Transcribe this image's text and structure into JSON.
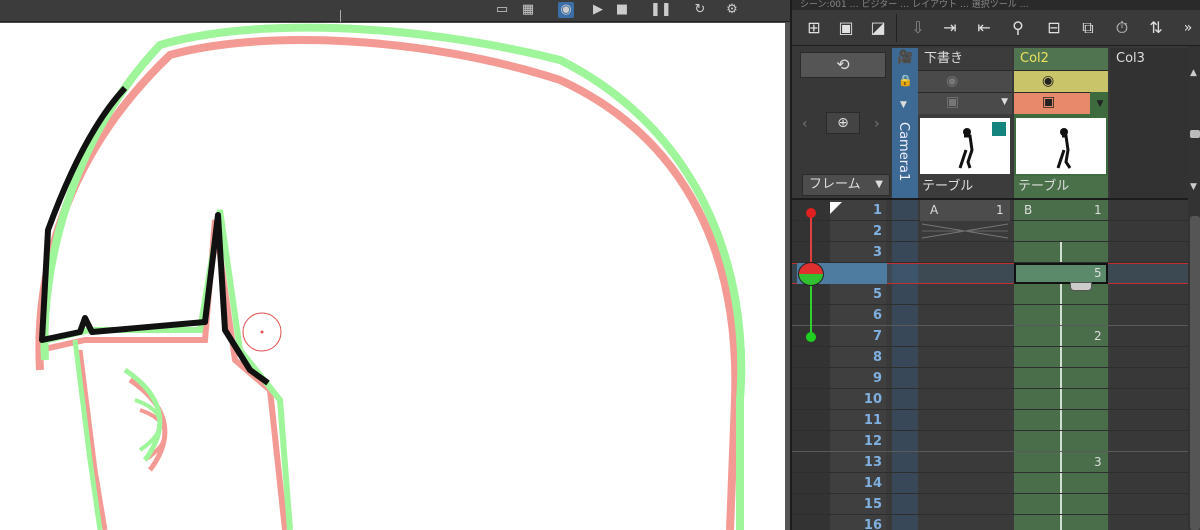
{
  "viewer": {
    "toolbar_icons": [
      "frame-icon",
      "grid-icon",
      "onion-skin-icon",
      "play-icon",
      "camera-icon",
      "pause-icon",
      "refresh-icon",
      "settings-icon"
    ]
  },
  "xsheet": {
    "title_text": "シーン:001 … ビジター … レイアウト … 選択ツール …",
    "toolbar_buttons": [
      "new-raster-level-icon",
      "new-toonz-level-icon",
      "new-vector-level-icon",
      "collapse-icon",
      "import-icon",
      "export-icon",
      "scene-cast-icon",
      "new-column-icon",
      "new-frame-icon",
      "timer-icon",
      "sort-icon"
    ],
    "more": "»",
    "frame_mode_label": "フレーム",
    "camera_label": "Camera1",
    "columns": [
      {
        "name": "下書き",
        "foot": "テーブル",
        "active": false
      },
      {
        "name": "Col2",
        "foot": "テーブル",
        "active": true
      },
      {
        "name": "Col3",
        "foot": "",
        "active": false
      }
    ],
    "frames": [
      "1",
      "2",
      "3",
      "4",
      "5",
      "6",
      "7",
      "8",
      "9",
      "10",
      "11",
      "12",
      "13",
      "14",
      "15",
      "16"
    ],
    "current_frame": "4",
    "col1_cells": [
      {
        "row": 1,
        "level": "A",
        "frame": "1"
      }
    ],
    "col2_cells": [
      {
        "row": 1,
        "level": "B",
        "frame": "1"
      },
      {
        "row": 4,
        "level": "",
        "frame": "5"
      },
      {
        "row": 7,
        "level": "",
        "frame": "2"
      },
      {
        "row": 13,
        "level": "",
        "frame": "3"
      }
    ]
  },
  "colors": {
    "active_column": "#4a6e4a",
    "active_header": "#3d6b3d",
    "camera_column": "#3d6a94",
    "onion_back": "#f08080",
    "onion_front": "#80f080",
    "current_row": "#4d7ca0"
  }
}
